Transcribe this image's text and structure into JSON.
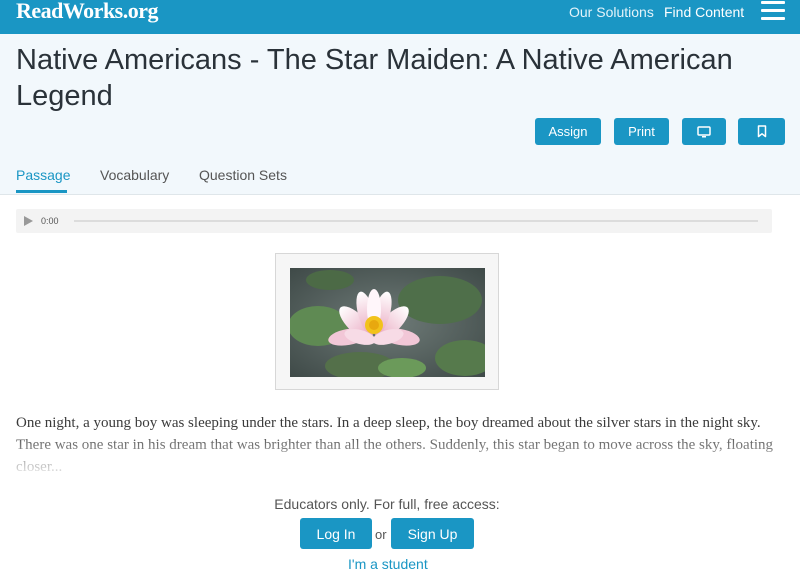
{
  "topbar": {
    "logo": "ReadWorks.org",
    "nav": [
      "Our Solutions",
      "Find Content"
    ],
    "menu_icon": "hamburger-menu-icon"
  },
  "header": {
    "title": "Native Americans - The Star Maiden: A Native American Legend",
    "buttons": {
      "assign": "Assign",
      "print": "Print",
      "display_icon": "monitor-icon",
      "bookmark_icon": "bookmark-icon"
    },
    "tabs": [
      "Passage",
      "Vocabulary",
      "Question Sets"
    ],
    "active_tab": "Passage"
  },
  "audio": {
    "time": "0:00",
    "play_icon": "play-icon",
    "progress": 0
  },
  "image": {
    "subject": "pink water lily flower on pond"
  },
  "passage": {
    "text": "One night, a young boy was sleeping under the stars. In a deep sleep, the boy dreamed about the silver stars in the night sky. There was one star in his dream that was brighter than all the others. Suddenly, this star began to move across the sky, floating closer..."
  },
  "access": {
    "note": "Educators only. For full, free access:",
    "login": "Log In",
    "or": "or",
    "signup": "Sign Up",
    "student": "I'm a student"
  },
  "colors": {
    "brand": "#1a96c4",
    "header_bg": "#f2f8fc",
    "title": "#2a3239"
  }
}
